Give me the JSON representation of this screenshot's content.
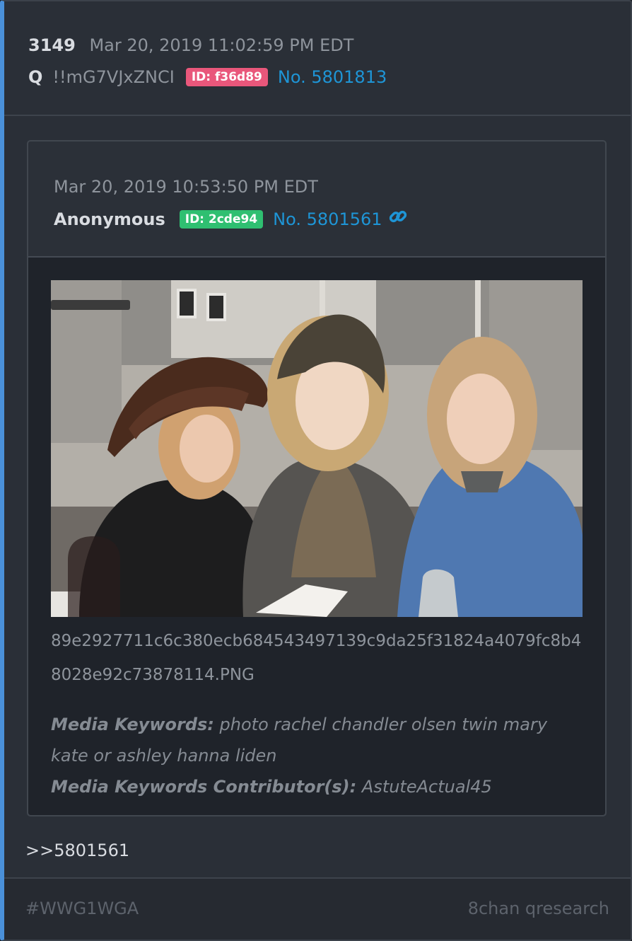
{
  "header": {
    "post_number": "3149",
    "timestamp": "Mar 20, 2019 11:02:59 PM EDT",
    "author": "Q",
    "tripcode": "!!mG7VJxZNCI",
    "id_badge": "ID: f36d89",
    "post_link": "No. 5801813"
  },
  "quoted_post": {
    "timestamp": "Mar 20, 2019 10:53:50 PM EDT",
    "author": "Anonymous",
    "id_badge": "ID: 2cde94",
    "post_link": "No. 5801561",
    "link_icon": "chain-link-icon",
    "image_filename": "89e2927711c6c380ecb684543497139c9da25f31824a4079fc8b48028e92c73878114.PNG",
    "keywords_label": "Media Keywords:",
    "keywords_value": "photo rachel chandler olsen twin mary kate or ashley hanna liden",
    "contributors_label": "Media Keywords Contributor(s):",
    "contributors_value": "AstuteActual45"
  },
  "reply_text": ">>5801561",
  "footer": {
    "hashtag": "#WWG1WGA",
    "source": "8chan qresearch"
  },
  "colors": {
    "accent": "#4a90d9",
    "link": "#1e95d6",
    "badge_red": "#e9577b",
    "badge_green": "#2fbf71"
  }
}
